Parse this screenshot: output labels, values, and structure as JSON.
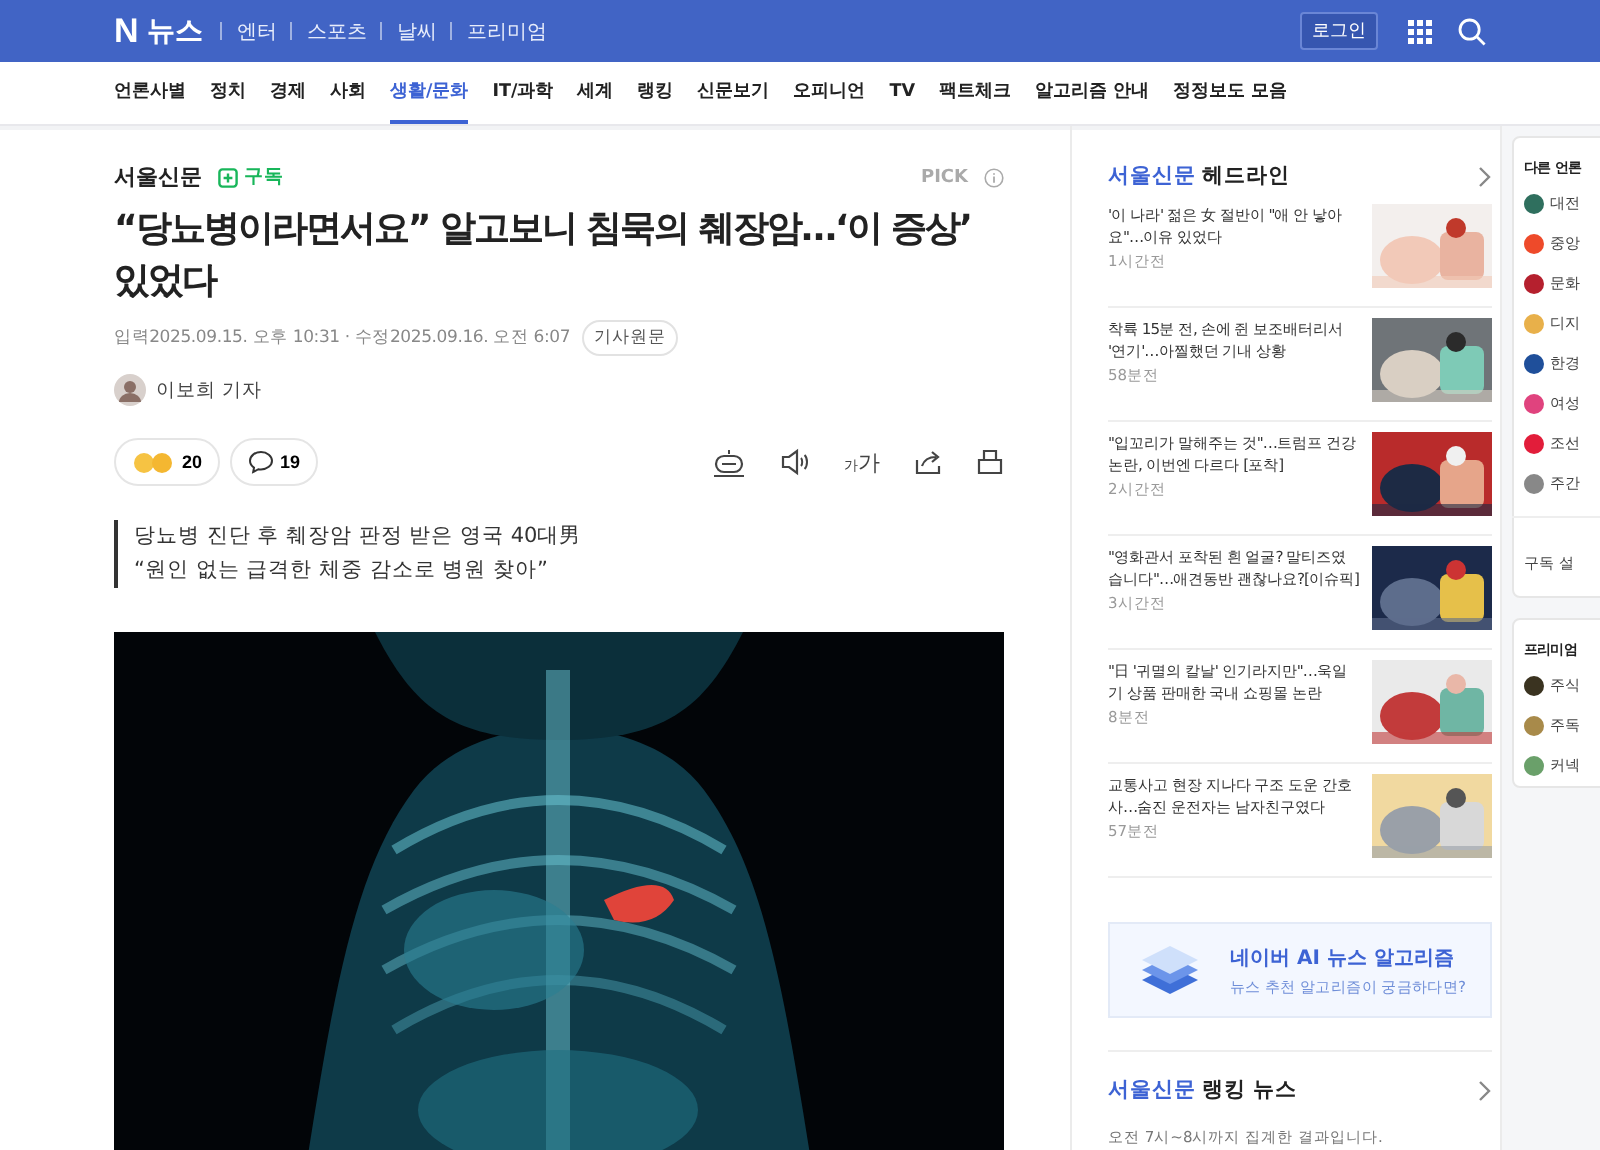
{
  "header": {
    "logo_mark": "N",
    "logo_text": "뉴스",
    "links": [
      "엔터",
      "스포츠",
      "날씨",
      "프리미엄"
    ],
    "login": "로그인"
  },
  "nav": [
    {
      "label": "언론사별",
      "selected": false
    },
    {
      "label": "정치",
      "selected": false
    },
    {
      "label": "경제",
      "selected": false
    },
    {
      "label": "사회",
      "selected": false
    },
    {
      "label": "생활/문화",
      "selected": true
    },
    {
      "label": "IT/과학",
      "selected": false
    },
    {
      "label": "세계",
      "selected": false
    },
    {
      "label": "랭킹",
      "selected": false
    },
    {
      "label": "신문보기",
      "selected": false
    },
    {
      "label": "오피니언",
      "selected": false
    },
    {
      "label": "TV",
      "selected": false
    },
    {
      "label": "팩트체크",
      "selected": false
    },
    {
      "label": "알고리즘 안내",
      "selected": false
    },
    {
      "label": "정정보도 모음",
      "selected": false
    }
  ],
  "article": {
    "press": "서울신문",
    "subscribe": "구독",
    "pick": "PICK",
    "title": "“당뇨병이라면서요” 알고보니 침묵의 췌장암…‘이 증상’ 있었다",
    "meta": "입력2025.09.15. 오후 10:31 · 수정2025.09.16. 오전 6:07",
    "original_link": "기사원문",
    "author": "이보희 기자",
    "reactions": "20",
    "comments": "19",
    "font_small": "가",
    "font_large": "가",
    "subtitle": [
      "당뇨병 진단 후 췌장암 판정 받은 영국 40대男",
      "“원인 없는 급격한 체중 감소로 병원 찾아”"
    ]
  },
  "headline": {
    "press": "서울신문",
    "title": "헤드라인",
    "items": [
      {
        "title": "'이 나라' 젊은 女 절반이 \"애 안 낳아요\"…이유 있었다",
        "time": "1시간전"
      },
      {
        "title": "착륙 15분 전, 손에 쥔 보조배터리서 '연기'…아찔했던 기내 상황",
        "time": "58분전"
      },
      {
        "title": "\"입꼬리가 말해주는 것\"…트럼프 건강 논란, 이번엔 다르다 [포착]",
        "time": "2시간전"
      },
      {
        "title": "\"영화관서 포착된 흰 얼굴? 말티즈였습니다\"…애견동반 괜찮나요?[이슈픽]",
        "time": "3시간전"
      },
      {
        "title": "\"日 '귀멸의 칼날' 인기라지만\"…욱일기 상품 판매한 국내 쇼핑몰 논란",
        "time": "8분전"
      },
      {
        "title": "교통사고 현장 지나다 구조 도운 간호사…숨진 운전자는 남자친구였다",
        "time": "57분전"
      }
    ]
  },
  "ai_banner": {
    "title": "네이버 AI 뉴스 알고리즘",
    "subtitle": "뉴스 추천 알고리즘이 궁금하다면?"
  },
  "ranking": {
    "press": "서울신문",
    "title": "랭킹 뉴스",
    "note": "오전 7시~8시까지 집계한 결과입니다."
  },
  "other_press": {
    "title": "다른 언론",
    "items": [
      {
        "name": "대전",
        "color": "#2f6f5e"
      },
      {
        "name": "중앙",
        "color": "#ee4a2a"
      },
      {
        "name": "문화",
        "color": "#b5202e"
      },
      {
        "name": "디지",
        "color": "#e8b04a"
      },
      {
        "name": "한경",
        "color": "#1f4f9a"
      },
      {
        "name": "여성",
        "color": "#e0437e"
      },
      {
        "name": "조선",
        "color": "#e21d3a"
      },
      {
        "name": "주간",
        "color": "#888888"
      }
    ],
    "settings": "구독 설"
  },
  "premium": {
    "title": "프리미엄",
    "items": [
      {
        "name": "주식",
        "color": "#3a3320"
      },
      {
        "name": "주독",
        "color": "#a88a4a"
      },
      {
        "name": "커넥",
        "color": "#6aa06a"
      }
    ]
  }
}
